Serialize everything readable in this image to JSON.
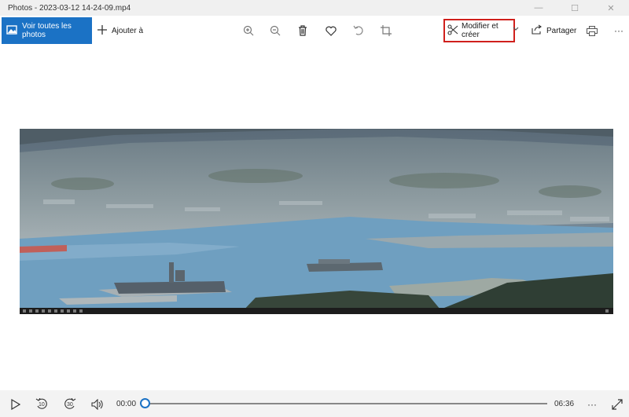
{
  "window": {
    "title": "Photos - 2023-03-12 14-24-09.mp4",
    "minimize_glyph": "—",
    "maximize_glyph": "☐",
    "close_glyph": "✕"
  },
  "toolbar": {
    "view_all_label": "Voir toutes les photos",
    "add_label": "Ajouter à",
    "edit_label": "Modifier et créer",
    "share_label": "Partager",
    "more_glyph": "···",
    "tools": [
      "zoom-in-icon",
      "zoom-out-icon",
      "delete-icon",
      "favorite-icon",
      "rotate-icon",
      "crop-icon"
    ]
  },
  "player": {
    "current_time": "00:00",
    "total_time": "06:36",
    "rewind_label": "10",
    "forward_label": "30",
    "more_glyph": "···",
    "progress": 0
  },
  "colors": {
    "accent": "#1b72c5",
    "highlight_box": "#d0201c"
  }
}
